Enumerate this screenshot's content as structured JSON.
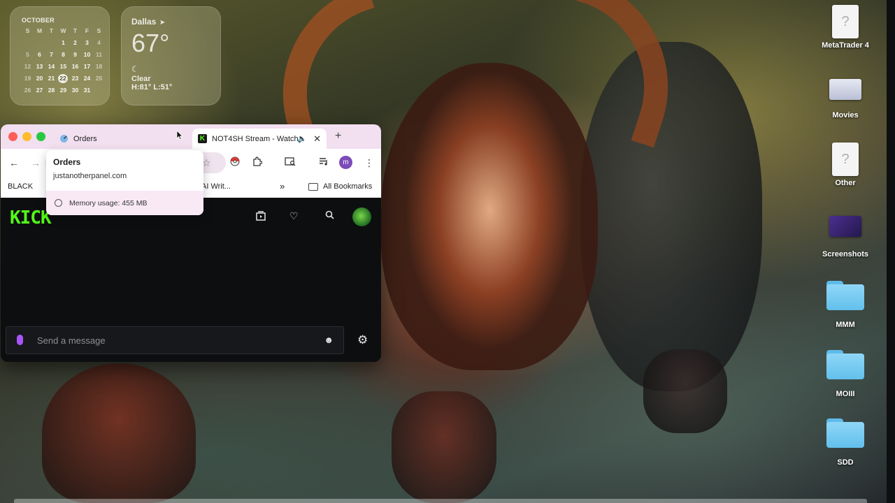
{
  "calendar": {
    "month": "OCTOBER",
    "weekdays": [
      "S",
      "M",
      "T",
      "W",
      "T",
      "F",
      "S"
    ],
    "weeks": [
      [
        "",
        "",
        "",
        "1",
        "2",
        "3",
        "4"
      ],
      [
        "5",
        "6",
        "7",
        "8",
        "9",
        "10",
        "11"
      ],
      [
        "12",
        "13",
        "14",
        "15",
        "16",
        "17",
        "18"
      ],
      [
        "19",
        "20",
        "21",
        "22",
        "23",
        "24",
        "25"
      ],
      [
        "26",
        "27",
        "28",
        "29",
        "30",
        "31",
        ""
      ]
    ],
    "today": "22"
  },
  "weather": {
    "city": "Dallas",
    "temp": "67°",
    "condition": "Clear",
    "high_low": "H:81° L:51°"
  },
  "browser": {
    "tabs": [
      {
        "title": "Orders",
        "active": false
      },
      {
        "title": "NOT4SH Stream - Watch",
        "active": true
      }
    ],
    "bookmarks": {
      "black": "BLACK",
      "ai": "AI Writ...",
      "all": "All Bookmarks"
    },
    "profile_initial": "m"
  },
  "hovercard": {
    "title": "Orders",
    "url": "justanotherpanel.com",
    "memory": "Memory usage: 455 MB"
  },
  "kick": {
    "logo": "KICK",
    "chat_placeholder": "Send a message"
  },
  "desktop_icons": [
    {
      "label": "MetaTrader 4"
    },
    {
      "label": "Movies"
    },
    {
      "label": "Other"
    },
    {
      "label": "Screenshots"
    },
    {
      "label": "MMM"
    },
    {
      "label": "MOIII"
    },
    {
      "label": "SDD"
    }
  ],
  "colors": {
    "kick_green": "#53fc18",
    "tabbar_pink": "#f2dff0",
    "folder_blue": "#62c0ec"
  }
}
